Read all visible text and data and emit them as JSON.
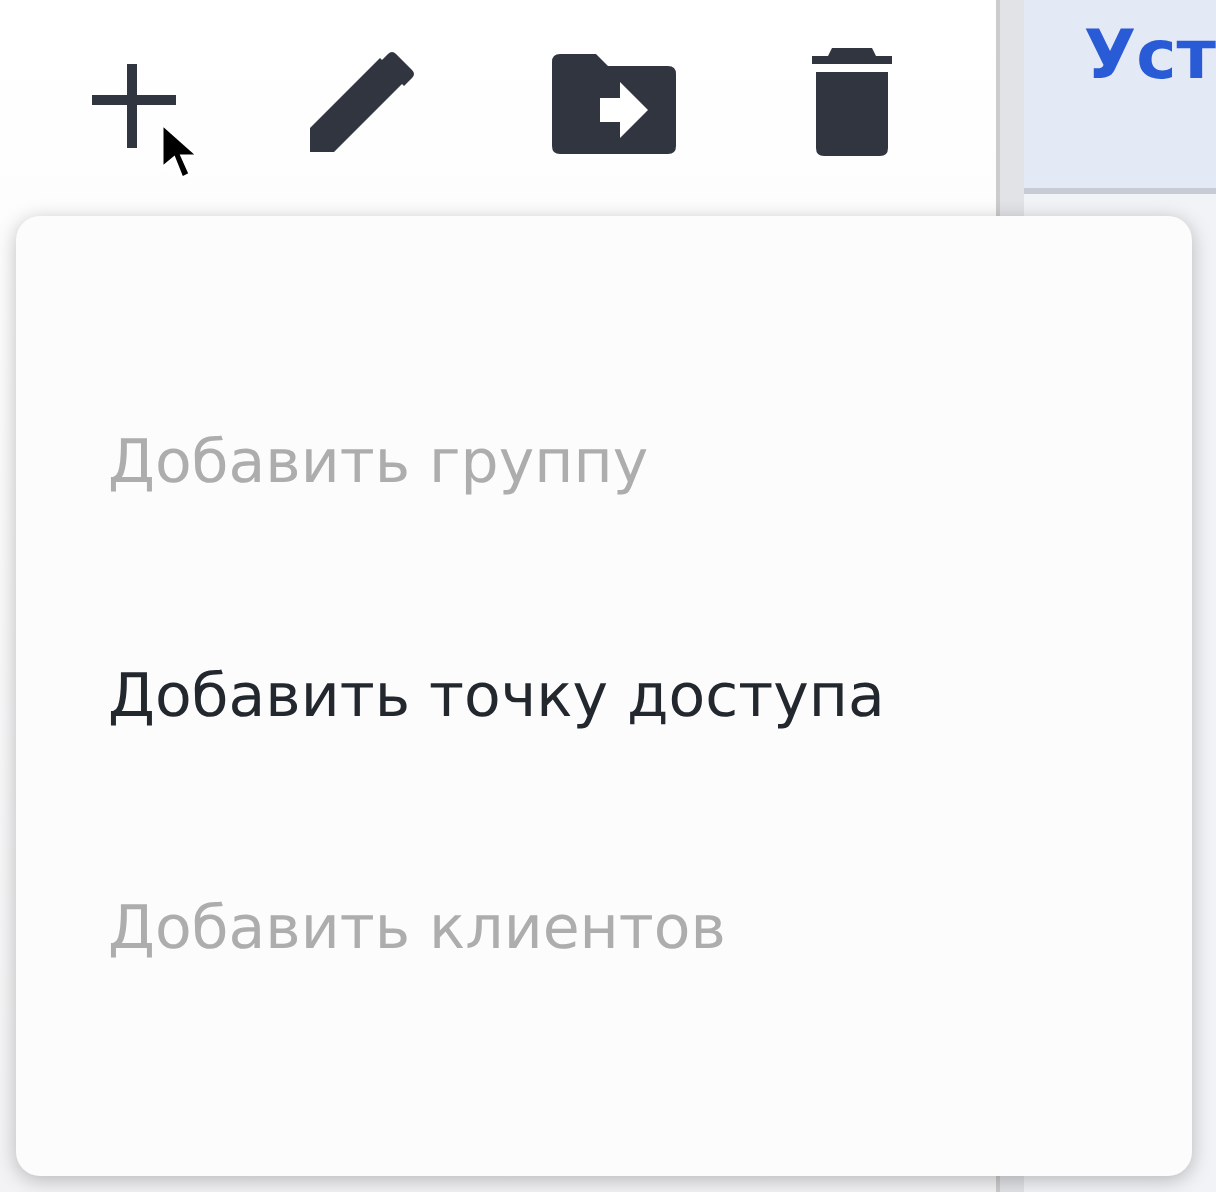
{
  "toolbar": {
    "buttons": [
      {
        "kind": "add"
      },
      {
        "kind": "edit"
      },
      {
        "kind": "move"
      },
      {
        "kind": "delete"
      }
    ]
  },
  "right_panel": {
    "header": "Уст"
  },
  "menu": {
    "items": [
      {
        "label": "Добавить группу",
        "disabled": true
      },
      {
        "label": "Добавить точку доступа",
        "disabled": false
      },
      {
        "label": "Добавить клиентов",
        "disabled": true
      }
    ]
  }
}
